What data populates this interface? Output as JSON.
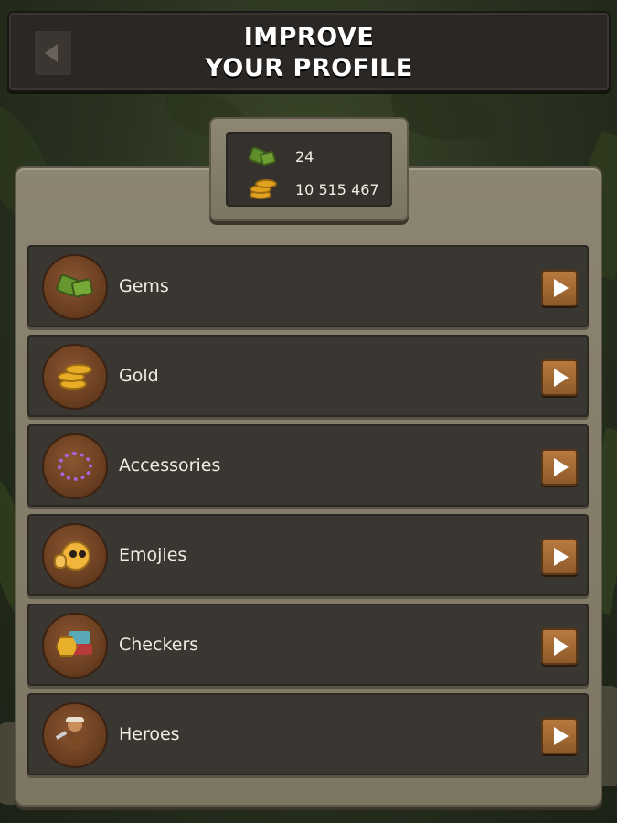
{
  "header": {
    "title_line1": "IMPROVE",
    "title_line2": "YOUR PROFILE"
  },
  "currency": {
    "gems": {
      "value": "24",
      "icon": "gem-icon"
    },
    "gold": {
      "value": "10 515 467",
      "icon": "gold-coin-icon"
    }
  },
  "menu": {
    "items": [
      {
        "label": "Gems",
        "icon": "gem-icon"
      },
      {
        "label": "Gold",
        "icon": "gold-coin-icon"
      },
      {
        "label": "Accessories",
        "icon": "accessory-ring-icon"
      },
      {
        "label": "Emojies",
        "icon": "emoji-face-icon"
      },
      {
        "label": "Checkers",
        "icon": "checker-pieces-icon"
      },
      {
        "label": "Heroes",
        "icon": "hero-miner-icon"
      }
    ]
  },
  "colors": {
    "panel_stone": "#847d69",
    "row_bg": "#3a3632",
    "button_wood": "#a46b35",
    "text": "#f0ebe3"
  }
}
